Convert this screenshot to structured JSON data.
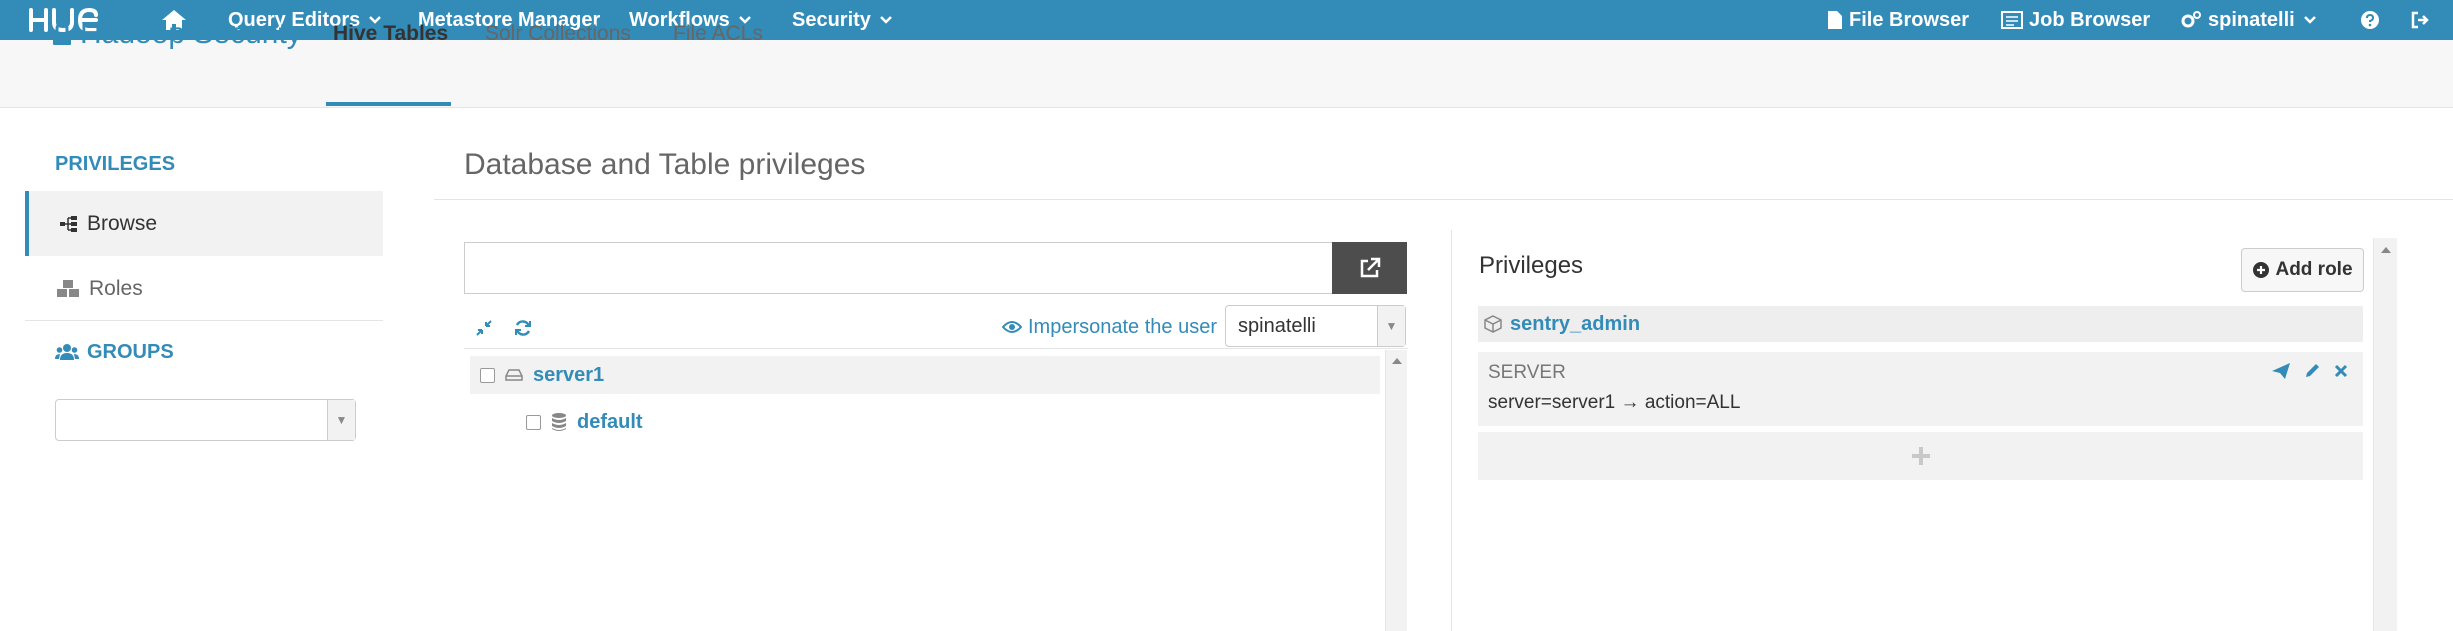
{
  "topnav": {
    "logo": "HUE",
    "home_icon": "home-icon",
    "query_editors": "Query Editors",
    "metastore": "Metastore Manager",
    "workflows": "Workflows",
    "security": "Security",
    "file_browser": "File Browser",
    "job_browser": "Job Browser",
    "user": "spinatelli"
  },
  "subnav": {
    "app_title": "Hadoop Security",
    "tabs": [
      {
        "label": "Hive Tables",
        "active": true
      },
      {
        "label": "Solr Collections",
        "active": false
      },
      {
        "label": "File ACLs",
        "active": false
      }
    ]
  },
  "sidebar": {
    "privileges_header": "PRIVILEGES",
    "items": [
      {
        "label": "Browse",
        "icon": "sitemap-icon",
        "active": true
      },
      {
        "label": "Roles",
        "icon": "cubes-icon",
        "active": false
      }
    ],
    "groups_header": "GROUPS",
    "groups_select_value": ""
  },
  "main": {
    "title": "Database and Table privileges",
    "search_value": "",
    "impersonate_label": "Impersonate the user",
    "impersonate_user": "spinatelli",
    "tree": {
      "server": "server1",
      "database": "default"
    }
  },
  "privileges_panel": {
    "title": "Privileges",
    "add_role_label": "Add role",
    "role_name": "sentry_admin",
    "privilege": {
      "type": "SERVER",
      "server": "server=server1",
      "arrow": "→",
      "action": "action=ALL"
    }
  },
  "colors": {
    "brand_blue": "#338bb8",
    "dark_button": "#4d4d4d"
  }
}
